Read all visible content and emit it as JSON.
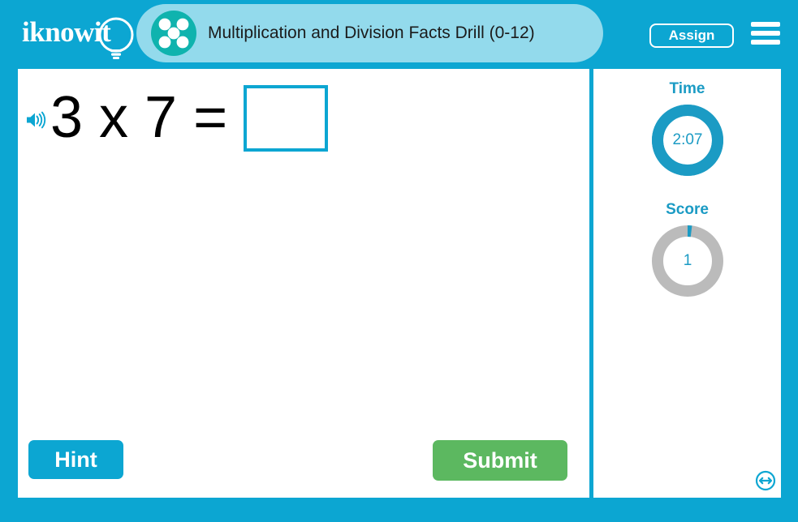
{
  "brand": {
    "logo_text": "iknowit",
    "logo_icon": "lightbulb-icon"
  },
  "header": {
    "subject_icon": "dice-five-dots-icon",
    "activity_title": "Multiplication and Division Facts Drill (0-12)",
    "assign_label": "Assign",
    "menu_icon": "hamburger-menu-icon",
    "bar_color": "#0CA6D2",
    "title_pill_color": "#93DAEC",
    "subject_icon_color": "#0FB3AE"
  },
  "question": {
    "audio_icon": "speaker-icon",
    "expression": "3 x 7 =",
    "answer_value": "",
    "answer_placeholder": "",
    "answer_border_color": "#0CA6D2"
  },
  "actions": {
    "hint_label": "Hint",
    "hint_color": "#0CA6D2",
    "submit_label": "Submit",
    "submit_color": "#5CB860"
  },
  "sidebar": {
    "time": {
      "label": "Time",
      "value": "2:07",
      "ring_progress_percent": 100,
      "ring_color": "#1B9BC4",
      "track_color": "#1B9BC4"
    },
    "score": {
      "label": "Score",
      "value": "1",
      "ring_progress_percent": 2,
      "ring_color": "#1B9BC4",
      "track_color": "#BBBBBB"
    }
  },
  "footer": {
    "resize_icon": "resize-horizontal-icon",
    "resize_icon_color": "#0CA6D2"
  }
}
